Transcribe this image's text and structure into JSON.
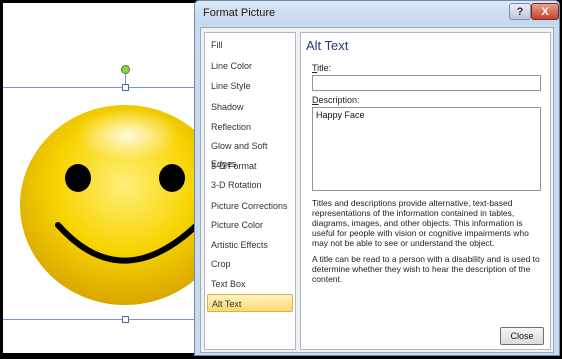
{
  "dialog": {
    "title": "Format Picture",
    "help_glyph": "?",
    "close_glyph": "X"
  },
  "sidebar": {
    "items": [
      {
        "label": "Fill"
      },
      {
        "label": "Line Color"
      },
      {
        "label": "Line Style"
      },
      {
        "label": "Shadow"
      },
      {
        "label": "Reflection"
      },
      {
        "label": "Glow and Soft Edges"
      },
      {
        "label": "3-D Format"
      },
      {
        "label": "3-D Rotation"
      },
      {
        "label": "Picture Corrections"
      },
      {
        "label": "Picture Color"
      },
      {
        "label": "Artistic Effects"
      },
      {
        "label": "Crop"
      },
      {
        "label": "Text Box"
      },
      {
        "label": "Alt Text"
      }
    ],
    "selected_index": 13
  },
  "panel": {
    "heading": "Alt Text",
    "title_label_mnemonic": "T",
    "title_label_rest": "itle:",
    "title_value": "",
    "description_label_mnemonic": "D",
    "description_label_rest": "escription:",
    "description_value": "Happy Face",
    "help_para1": "Titles and descriptions provide alternative, text-based representations of the information contained in tables, diagrams, images, and other objects. This information is useful for people with vision or cognitive impairments who may not be able to see or understand the object.",
    "help_para2": "A title can be read to a person with a disability and is used to determine whether they wish to hear the description of the content.",
    "close_label": "Close"
  },
  "colors": {
    "selection_accent": "#fbd96b",
    "heading_color": "#1f3c73",
    "smiley_yellow": "#f6d000"
  }
}
